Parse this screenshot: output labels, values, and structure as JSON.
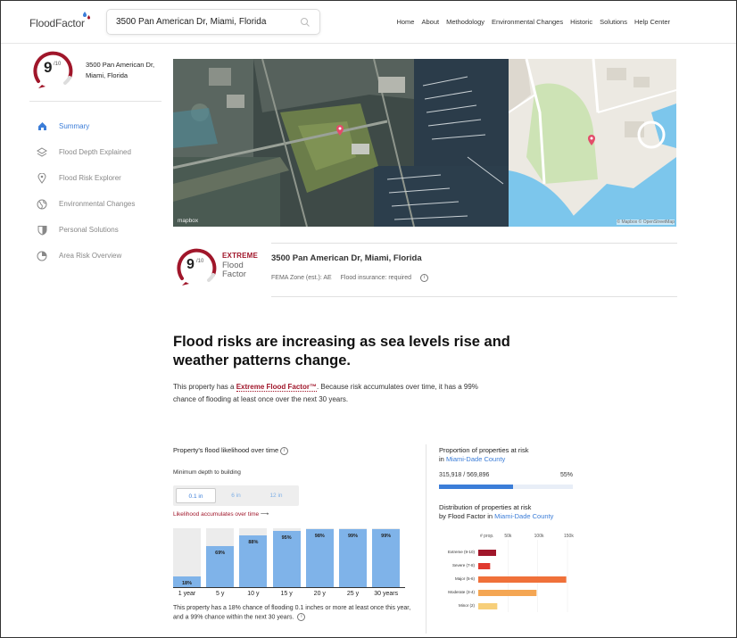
{
  "header": {
    "logo_text": "FloodFactor",
    "search_value": "3500 Pan American Dr, Miami, Florida",
    "nav": [
      "Home",
      "About",
      "Methodology",
      "Environmental Changes",
      "Historic",
      "Solutions",
      "Help Center"
    ]
  },
  "sidebar": {
    "score": "9",
    "score_max": "/10",
    "address_line1": "3500 Pan American Dr,",
    "address_line2": "Miami, Florida",
    "items": [
      {
        "label": "Summary",
        "icon": "home-icon",
        "active": true
      },
      {
        "label": "Flood Depth Explained",
        "icon": "layers-icon",
        "active": false
      },
      {
        "label": "Flood Risk Explorer",
        "icon": "map-pin-icon",
        "active": false
      },
      {
        "label": "Environmental Changes",
        "icon": "globe-icon",
        "active": false
      },
      {
        "label": "Personal Solutions",
        "icon": "shield-icon",
        "active": false
      },
      {
        "label": "Area Risk Overview",
        "icon": "pie-icon",
        "active": false
      }
    ]
  },
  "maps": {
    "satellite_attribution": "mapbox",
    "road_attribution": "© Mapbox © OpenStreetMap"
  },
  "property": {
    "score": "9",
    "score_max": "/10",
    "rating_label": "EXTREME",
    "brand_line1": "Flood",
    "brand_line2": "Factor",
    "address": "3500 Pan American Dr, Miami, Florida",
    "fema_zone": "FEMA Zone (est.): AE",
    "insurance": "Flood insurance: required"
  },
  "summary": {
    "headline": "Flood risks are increasing as sea levels rise and weather patterns change.",
    "lede_pre": "This property has a ",
    "lede_factor": "Extreme Flood Factor™",
    "lede_post": ". Because risk accumulates over time, it has a 99% chance of flooding at least once over the next 30 years."
  },
  "likelihood": {
    "title": "Property's flood likelihood over time",
    "min_depth_label": "Minimum depth to building",
    "depth_options": [
      "0.1 in",
      "6 in",
      "12 in"
    ],
    "active_depth": "0.1 in",
    "accumulates_link": "Likelihood accumulates over time",
    "note": "This property has a 18% chance of flooding 0.1 inches or more at least once this year, and a 99% chance within the next 30 years."
  },
  "chart_data": [
    {
      "type": "bar",
      "title": "Property's flood likelihood over time",
      "categories": [
        "1 year",
        "5 y",
        "10 y",
        "15 y",
        "20 y",
        "25 y",
        "30 years"
      ],
      "values": [
        18,
        69,
        88,
        95,
        98,
        99,
        99
      ],
      "data_labels": [
        "18%",
        "69%",
        "88%",
        "95%",
        "98%",
        "99%",
        "99%"
      ],
      "ylim": [
        0,
        100
      ],
      "colors": {
        "bar": "#7fb3e9",
        "track": "#ececec"
      }
    },
    {
      "type": "bar",
      "title": "Distribution of properties at risk by Flood Factor in Miami-Dade County",
      "categories": [
        "Extreme (9-10)",
        "Severe (7-8)",
        "Major (5-6)",
        "Moderate (3-4)",
        "Minor (2)"
      ],
      "values": [
        30000,
        20000,
        148000,
        98000,
        32000
      ],
      "tick_labels": [
        "# prop.",
        "50k",
        "100k",
        "150k"
      ],
      "xlim": [
        0,
        150000
      ],
      "colors": [
        "#a0162a",
        "#e03a2f",
        "#f0713a",
        "#f4a653",
        "#f7cf7a"
      ]
    }
  ],
  "proportion": {
    "title": "Proportion of properties at risk",
    "in_label": "in",
    "county": "Miami-Dade County",
    "count_text": "315,918 / 569,896",
    "percent_text": "55%",
    "percent": 0.55,
    "accent": "#3b7dd8"
  },
  "distribution": {
    "title_line1": "Distribution of properties at risk",
    "title_line2": "by Flood Factor in",
    "county": "Miami-Dade County"
  }
}
